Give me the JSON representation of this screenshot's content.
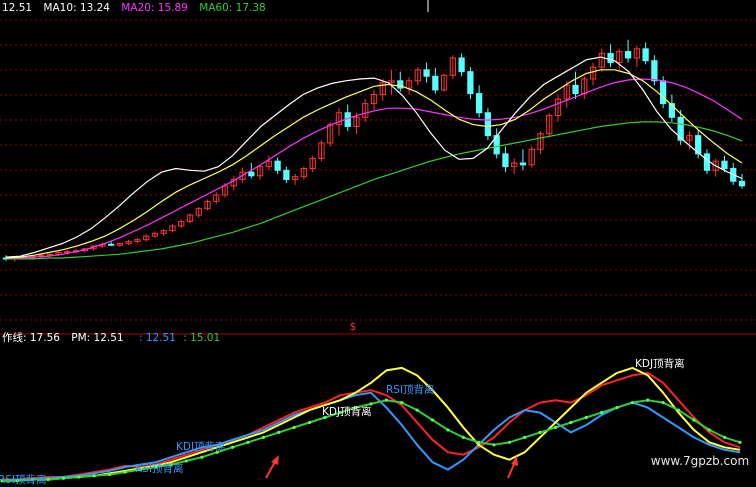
{
  "top_legend": [
    {
      "text": "12.51",
      "color": "#ffffff"
    },
    {
      "text": "MA10: 13.24",
      "color": "#ffffff"
    },
    {
      "text": "MA20: 15.89",
      "color": "#ff33ff"
    },
    {
      "text": "MA60: 17.38",
      "color": "#33cc33"
    }
  ],
  "price_marker": "$",
  "bottom_legend": [
    {
      "text": "作线: 17.56",
      "color": "#ffffff"
    },
    {
      "text": "PM: 12.51",
      "color": "#ffffff"
    },
    {
      "text": ": 12.51",
      "color": "#3399ff"
    },
    {
      "text": ": 15.01",
      "color": "#33cc33"
    }
  ],
  "annotations": [
    {
      "text": "KDJ顶背离",
      "color": "#ffffff"
    },
    {
      "text": "RSI顶背离",
      "color": "#3399ff"
    },
    {
      "text": "KDJ顶背离",
      "color": "#ffffff"
    },
    {
      "text": "KDJ顶背离",
      "color": "#3399ff"
    },
    {
      "text": "RSI顶背离",
      "color": "#3399ff"
    },
    {
      "text": "RSI顶背离",
      "color": "#3399ff"
    }
  ],
  "watermark": "www.7gpzb.com",
  "colors": {
    "up": "#ff3333",
    "down": "#55ffff",
    "ma5": "#ffffff",
    "ma10": "#ffff66",
    "ma20": "#ff33ff",
    "ma60": "#33cc33",
    "grid": "#8b0000",
    "osc_red": "#ff2222",
    "osc_blue": "#3399ff",
    "osc_yellow": "#ffff44",
    "osc_green": "#33cc33"
  },
  "chart_data": [
    {
      "type": "candlestick",
      "name": "price",
      "ylim": [
        0,
        30
      ],
      "ohlc": [
        [
          4.6,
          4.9,
          4.3,
          4.5
        ],
        [
          4.5,
          4.8,
          4.2,
          4.7
        ],
        [
          4.7,
          5.0,
          4.5,
          4.6
        ],
        [
          4.6,
          4.9,
          4.4,
          4.8
        ],
        [
          4.8,
          5.1,
          4.6,
          4.9
        ],
        [
          4.9,
          5.2,
          4.7,
          5.0
        ],
        [
          5.0,
          5.3,
          4.8,
          5.2
        ],
        [
          5.2,
          5.5,
          5.0,
          5.3
        ],
        [
          5.3,
          5.6,
          5.1,
          5.4
        ],
        [
          5.4,
          5.7,
          5.2,
          5.6
        ],
        [
          5.6,
          6.0,
          5.4,
          5.9
        ],
        [
          5.9,
          6.3,
          5.7,
          6.1
        ],
        [
          6.1,
          6.4,
          5.9,
          6.0
        ],
        [
          6.0,
          6.3,
          5.8,
          6.2
        ],
        [
          6.2,
          6.6,
          6.0,
          6.4
        ],
        [
          6.4,
          6.8,
          6.2,
          6.6
        ],
        [
          6.6,
          7.2,
          6.4,
          7.0
        ],
        [
          7.0,
          7.5,
          6.8,
          7.3
        ],
        [
          7.3,
          7.8,
          7.0,
          7.6
        ],
        [
          7.6,
          8.3,
          7.4,
          8.1
        ],
        [
          8.1,
          8.8,
          7.9,
          8.6
        ],
        [
          8.6,
          9.5,
          8.4,
          9.3
        ],
        [
          9.3,
          10.2,
          9.0,
          10.0
        ],
        [
          10.0,
          11.0,
          9.8,
          10.8
        ],
        [
          10.8,
          11.8,
          10.5,
          11.5
        ],
        [
          11.5,
          12.8,
          11.2,
          12.5
        ],
        [
          12.5,
          13.6,
          12.0,
          13.2
        ],
        [
          13.2,
          14.5,
          12.8,
          14.0
        ],
        [
          14.0,
          15.0,
          13.3,
          13.6
        ],
        [
          13.6,
          14.8,
          13.2,
          14.6
        ],
        [
          14.6,
          15.8,
          14.2,
          15.2
        ],
        [
          15.2,
          15.6,
          13.8,
          14.2
        ],
        [
          14.2,
          14.6,
          12.8,
          13.2
        ],
        [
          13.2,
          13.8,
          12.6,
          13.5
        ],
        [
          13.5,
          14.6,
          13.2,
          14.4
        ],
        [
          14.4,
          15.8,
          14.0,
          15.5
        ],
        [
          15.5,
          17.5,
          15.2,
          17.2
        ],
        [
          17.2,
          19.5,
          16.8,
          19.2
        ],
        [
          19.2,
          21.0,
          18.0,
          20.5
        ],
        [
          20.5,
          21.4,
          18.5,
          19.0
        ],
        [
          19.0,
          20.5,
          18.2,
          20.0
        ],
        [
          20.0,
          22.0,
          19.5,
          21.5
        ],
        [
          21.5,
          23.0,
          20.8,
          22.5
        ],
        [
          22.5,
          24.2,
          21.8,
          23.8
        ],
        [
          23.8,
          25.2,
          22.5,
          24.0
        ],
        [
          24.0,
          25.0,
          22.8,
          23.2
        ],
        [
          23.2,
          24.4,
          22.5,
          24.0
        ],
        [
          24.0,
          25.5,
          23.5,
          25.2
        ],
        [
          25.2,
          26.0,
          23.8,
          24.5
        ],
        [
          24.5,
          25.4,
          22.6,
          23.0
        ],
        [
          23.0,
          24.8,
          22.8,
          24.6
        ],
        [
          24.6,
          26.8,
          24.2,
          26.5
        ],
        [
          26.5,
          27.0,
          24.5,
          25.0
        ],
        [
          25.0,
          25.5,
          22.0,
          22.6
        ],
        [
          22.6,
          23.5,
          20.0,
          20.5
        ],
        [
          20.5,
          21.0,
          17.5,
          18.0
        ],
        [
          18.0,
          18.8,
          15.5,
          16.0
        ],
        [
          16.0,
          16.8,
          14.0,
          14.6
        ],
        [
          14.6,
          15.5,
          13.8,
          15.0
        ],
        [
          15.0,
          16.5,
          14.2,
          14.8
        ],
        [
          14.8,
          16.8,
          14.5,
          16.5
        ],
        [
          16.5,
          18.5,
          16.0,
          18.2
        ],
        [
          18.2,
          20.5,
          17.8,
          20.2
        ],
        [
          20.2,
          22.5,
          19.5,
          22.0
        ],
        [
          22.0,
          24.0,
          21.0,
          23.5
        ],
        [
          23.5,
          25.0,
          22.0,
          22.6
        ],
        [
          22.6,
          24.5,
          22.0,
          24.2
        ],
        [
          24.2,
          26.0,
          23.5,
          25.5
        ],
        [
          25.5,
          27.5,
          25.0,
          27.0
        ],
        [
          27.0,
          28.0,
          25.5,
          26.0
        ],
        [
          26.0,
          27.5,
          25.2,
          27.2
        ],
        [
          27.2,
          28.5,
          26.0,
          26.5
        ],
        [
          26.5,
          27.8,
          25.5,
          27.5
        ],
        [
          27.5,
          28.2,
          25.8,
          26.2
        ],
        [
          26.2,
          26.8,
          23.5,
          24.0
        ],
        [
          24.0,
          24.5,
          21.0,
          21.5
        ],
        [
          21.5,
          22.5,
          19.5,
          20.0
        ],
        [
          20.0,
          20.8,
          17.0,
          17.5
        ],
        [
          17.5,
          18.5,
          16.5,
          18.0
        ],
        [
          18.0,
          18.6,
          15.5,
          16.0
        ],
        [
          16.0,
          16.5,
          13.8,
          14.2
        ],
        [
          14.2,
          15.5,
          13.5,
          15.2
        ],
        [
          15.2,
          15.8,
          14.0,
          14.4
        ],
        [
          14.4,
          15.0,
          12.6,
          13.0
        ],
        [
          13.0,
          13.8,
          12.2,
          12.5
        ]
      ],
      "ma5": [
        4.7,
        4.8,
        5.2,
        5.7,
        6.2,
        6.9,
        7.8,
        9.0,
        10.3,
        11.7,
        13.0,
        14.0,
        14.4,
        14.2,
        14.1,
        14.6,
        15.8,
        17.4,
        19.0,
        20.2,
        21.4,
        22.5,
        23.2,
        23.7,
        24.0,
        24.2,
        24.3,
        23.8,
        22.4,
        20.5,
        18.3,
        16.4,
        15.4,
        15.5,
        16.6,
        18.6,
        20.5,
        22.2,
        23.6,
        24.5,
        25.4,
        26.3,
        26.6,
        26.2,
        25.0,
        23.0,
        20.6,
        18.7,
        17.3,
        16.0,
        14.8,
        14.0,
        13.3
      ],
      "ma10": [
        4.6,
        4.7,
        4.9,
        5.2,
        5.5,
        5.9,
        6.4,
        7.0,
        7.8,
        8.7,
        9.7,
        10.8,
        11.8,
        12.6,
        13.3,
        14.0,
        14.8,
        15.8,
        16.9,
        18.0,
        19.0,
        20.0,
        20.8,
        21.5,
        22.2,
        22.8,
        23.4,
        23.6,
        23.4,
        22.8,
        21.9,
        20.8,
        19.8,
        19.2,
        19.0,
        19.2,
        19.8,
        20.8,
        22.0,
        23.0,
        24.0,
        24.8,
        25.2,
        25.2,
        24.8,
        24.0,
        22.8,
        21.4,
        19.9,
        18.5,
        17.2,
        16.0,
        15.0
      ],
      "ma20": [
        4.6,
        4.6,
        4.7,
        4.8,
        5.0,
        5.3,
        5.7,
        6.2,
        6.8,
        7.5,
        8.2,
        9.0,
        9.8,
        10.6,
        11.4,
        12.2,
        13.0,
        13.9,
        14.8,
        15.8,
        16.8,
        17.7,
        18.5,
        19.2,
        19.8,
        20.3,
        20.7,
        21.0,
        21.0,
        20.9,
        20.6,
        20.3,
        20.0,
        19.8,
        19.7,
        19.8,
        20.0,
        20.4,
        20.9,
        21.5,
        22.1,
        22.7,
        23.3,
        23.8,
        24.1,
        24.2,
        24.1,
        23.8,
        23.3,
        22.6,
        21.8,
        20.8,
        19.8
      ],
      "ma60": [
        4.5,
        4.5,
        4.5,
        4.6,
        4.6,
        4.7,
        4.8,
        4.9,
        5.0,
        5.2,
        5.4,
        5.6,
        5.9,
        6.2,
        6.6,
        7.0,
        7.4,
        7.9,
        8.4,
        9.0,
        9.6,
        10.2,
        10.8,
        11.4,
        12.0,
        12.6,
        13.2,
        13.7,
        14.2,
        14.7,
        15.2,
        15.6,
        16.0,
        16.3,
        16.6,
        16.9,
        17.2,
        17.5,
        17.8,
        18.1,
        18.4,
        18.7,
        19.0,
        19.2,
        19.4,
        19.5,
        19.5,
        19.4,
        19.2,
        18.9,
        18.5,
        18.0,
        17.4
      ]
    },
    {
      "type": "line",
      "name": "oscillator",
      "ylim": [
        0,
        100
      ],
      "series": [
        {
          "name": "",
          "color": "red",
          "values": [
            2,
            2,
            3,
            4,
            4,
            6,
            8,
            10,
            13,
            12,
            14,
            18,
            22,
            26,
            30,
            34,
            38,
            44,
            50,
            56,
            60,
            64,
            70,
            72,
            74,
            70,
            62,
            48,
            34,
            24,
            22,
            28,
            36,
            48,
            58,
            64,
            66,
            64,
            70,
            78,
            82,
            86,
            88,
            80,
            66,
            52,
            40,
            32,
            28
          ]
        },
        {
          "name": "",
          "color": "blue",
          "values": [
            1,
            2,
            2,
            3,
            4,
            5,
            7,
            9,
            12,
            14,
            16,
            20,
            24,
            28,
            30,
            34,
            38,
            42,
            48,
            54,
            58,
            62,
            66,
            70,
            72,
            60,
            46,
            30,
            16,
            10,
            18,
            30,
            42,
            52,
            58,
            56,
            48,
            40,
            46,
            54,
            60,
            64,
            60,
            52,
            44,
            36,
            30,
            26,
            24
          ]
        },
        {
          "name": "",
          "color": "yellow",
          "values": [
            1,
            1,
            2,
            2,
            3,
            4,
            5,
            7,
            9,
            11,
            13,
            16,
            20,
            24,
            28,
            32,
            36,
            40,
            46,
            52,
            58,
            62,
            66,
            72,
            80,
            90,
            92,
            86,
            74,
            60,
            44,
            30,
            22,
            18,
            24,
            36,
            48,
            60,
            72,
            80,
            88,
            92,
            86,
            72,
            56,
            42,
            32,
            28,
            26
          ]
        },
        {
          "name": "",
          "color": "green",
          "values": [
            1,
            1,
            2,
            2,
            3,
            4,
            5,
            6,
            8,
            10,
            12,
            14,
            17,
            20,
            24,
            28,
            32,
            36,
            40,
            44,
            48,
            52,
            56,
            60,
            63,
            66,
            64,
            58,
            50,
            42,
            36,
            32,
            30,
            32,
            36,
            40,
            44,
            48,
            52,
            56,
            60,
            64,
            66,
            64,
            58,
            50,
            42,
            36,
            32
          ]
        }
      ]
    }
  ]
}
